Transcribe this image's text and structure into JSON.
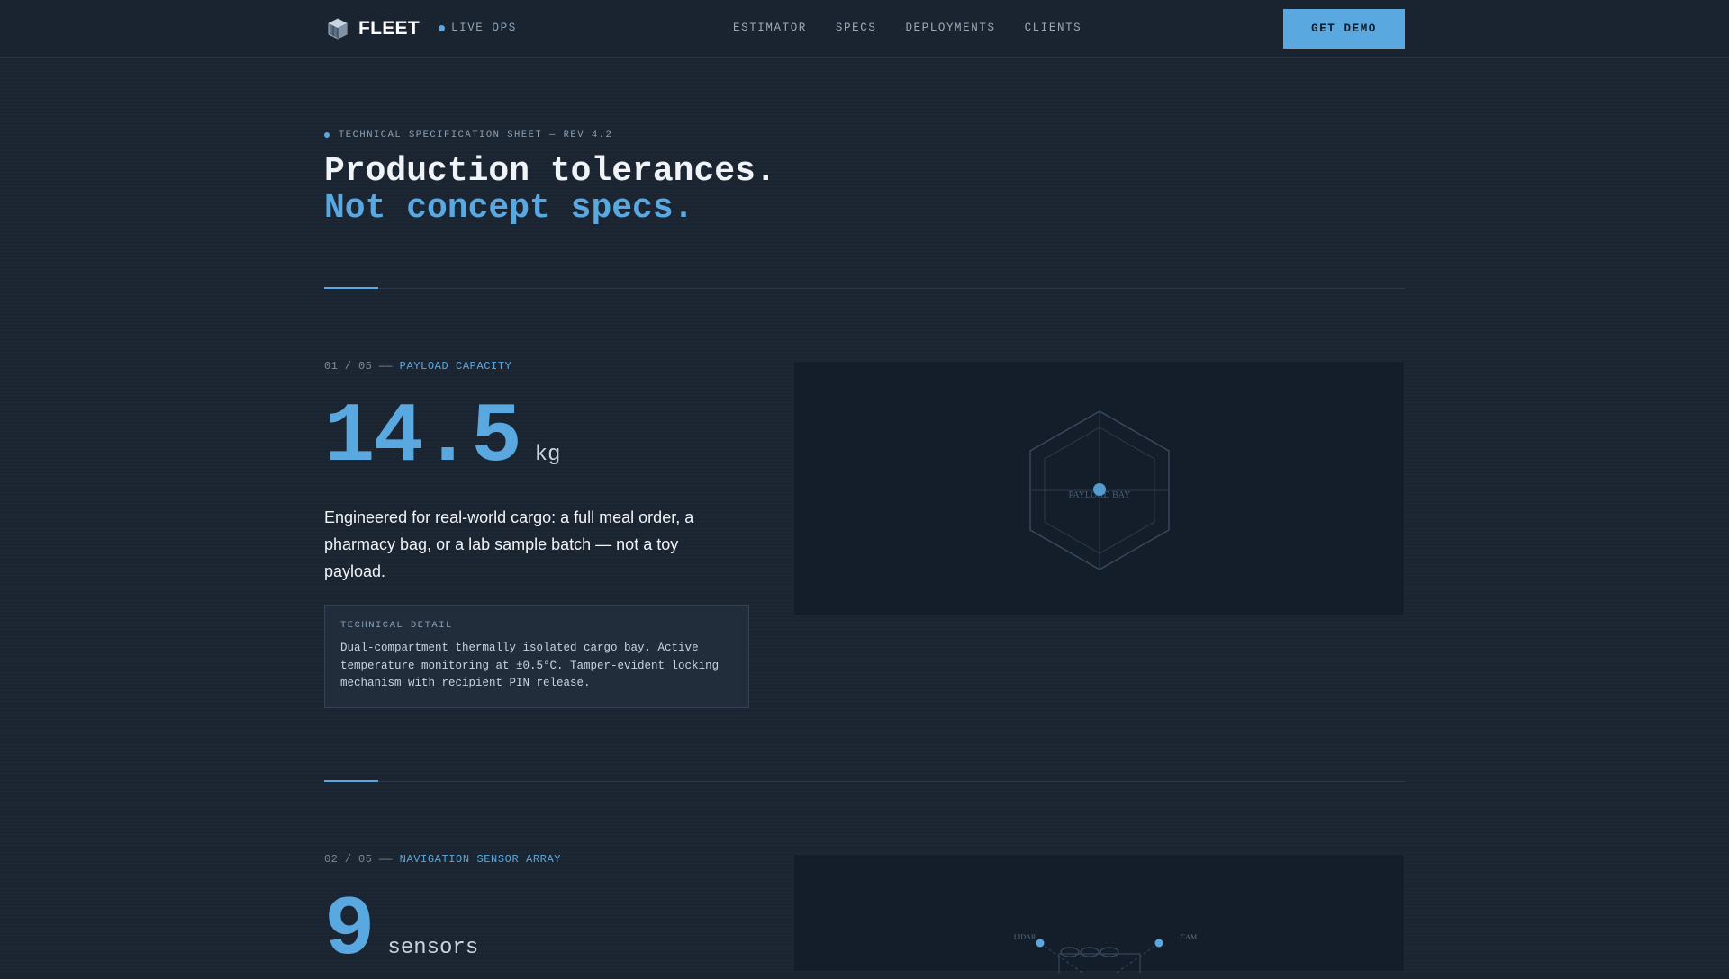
{
  "nav": {
    "brand": "FLEET",
    "status": "LIVE OPS",
    "links": [
      "ESTIMATOR",
      "SPECS",
      "DEPLOYMENTS",
      "CLIENTS"
    ],
    "cta": "GET DEMO"
  },
  "hero": {
    "eyebrow": "TECHNICAL SPECIFICATION SHEET — REV 4.2",
    "headline_line1": "Production tolerances.",
    "headline_line2": "Not concept specs."
  },
  "sections": [
    {
      "index": "01 / 05",
      "dash": "——",
      "name": "PAYLOAD CAPACITY",
      "value": "14.5",
      "unit": "kg",
      "description": "Engineered for real-world cargo: a full meal order, a pharmacy bag, or a lab sample batch — not a toy payload.",
      "detail_title": "TECHNICAL DETAIL",
      "detail_body": "Dual-compartment thermally isolated cargo bay. Active temperature monitoring at ±0.5°C. Tamper-evident locking mechanism with recipient PIN release.",
      "visual_label": "PAYLOAD BAY"
    },
    {
      "index": "02 / 05",
      "dash": "——",
      "name": "NAVIGATION SENSOR ARRAY",
      "value": "9",
      "unit": "sensors",
      "visual_labels": [
        "LIDAR",
        "CAM"
      ]
    }
  ],
  "colors": {
    "accent": "#5aa8e0",
    "background": "#1b2532",
    "panel": "#141e2a"
  }
}
